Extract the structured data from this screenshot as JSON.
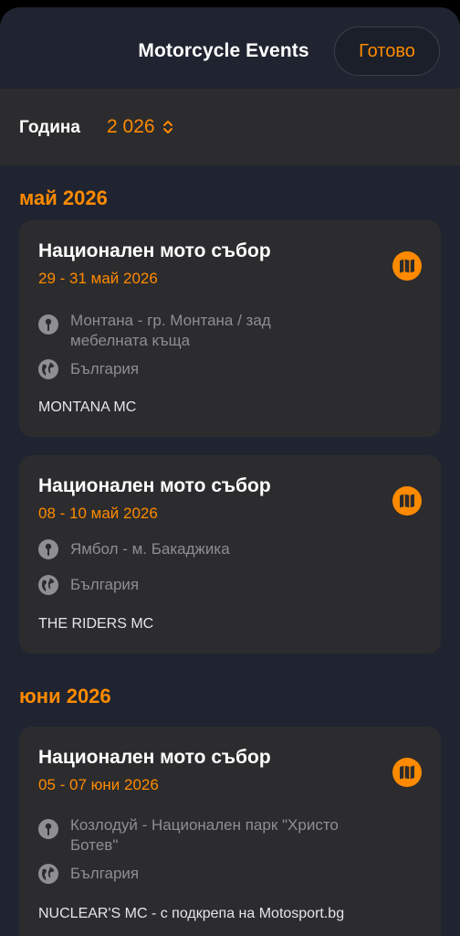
{
  "header": {
    "title": "Motorcycle Events",
    "done_label": "Готово"
  },
  "year_filter": {
    "label": "Година",
    "value": "2 026"
  },
  "months": [
    {
      "title": "май 2026",
      "events": [
        {
          "name": "Национален мото събор",
          "dates": "29 - 31 май 2026",
          "location": "Монтана - гр. Монтана / зад мебелната къща",
          "country": "България",
          "club": "MONTANA MC"
        },
        {
          "name": "Национален мото събор",
          "dates": "08 - 10 май 2026",
          "location": "Ямбол - м. Бакаджика",
          "country": "България",
          "club": "THE RIDERS MC"
        }
      ]
    },
    {
      "title": "юни 2026",
      "events": [
        {
          "name": "Национален мото събор",
          "dates": "05 - 07 юни 2026",
          "location": "Козлодуй - Национален парк \"Христо Ботев\"",
          "country": "България",
          "club": "NUCLEAR'S MC - с подкрепа на Motosport.bg"
        }
      ]
    }
  ],
  "colors": {
    "accent": "#ff8a00",
    "background": "#1f2430",
    "card": "#2c2c2e",
    "muted": "#8e8e93"
  },
  "icons": {
    "map": "map-icon",
    "pin": "pin-icon",
    "globe": "globe-icon",
    "chevron": "chevron-up-down-icon"
  }
}
